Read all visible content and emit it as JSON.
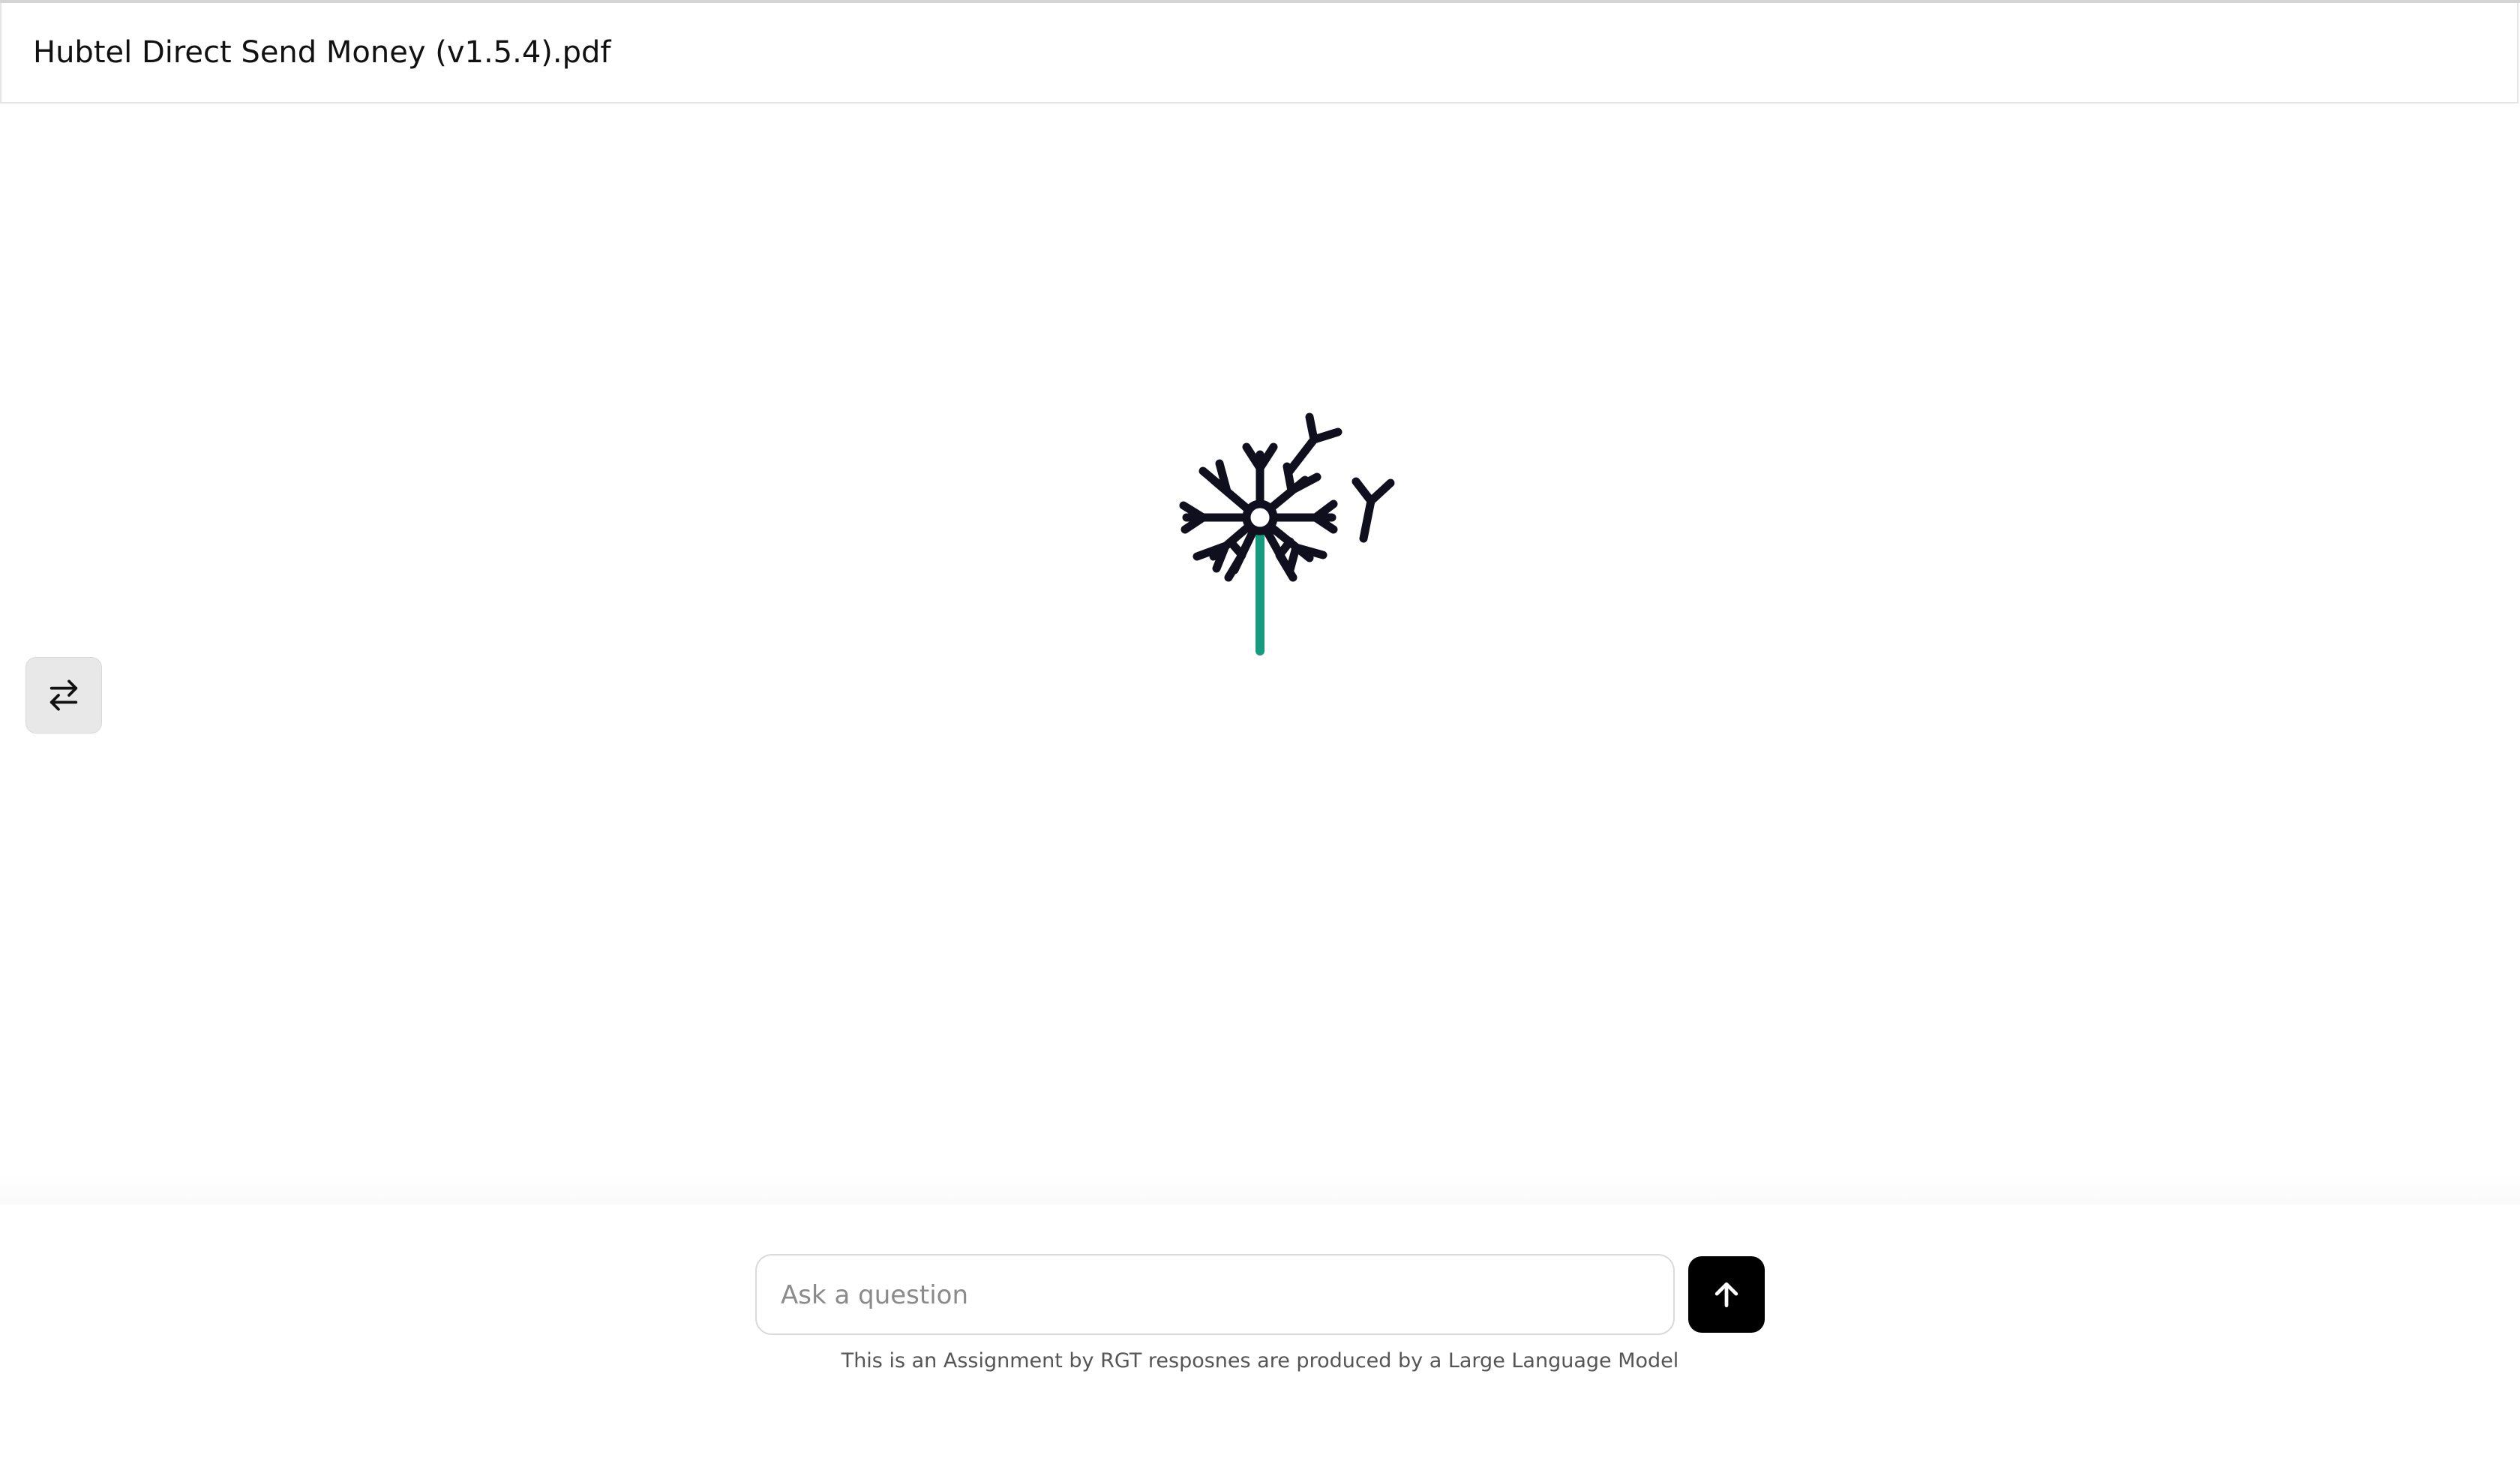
{
  "header": {
    "document_title": "Hubtel Direct Send Money (v1.5.4).pdf"
  },
  "logo": {
    "icon": "dandelion-logo-icon",
    "colors": {
      "head": "#0f0f1e",
      "stem": "#169b7f"
    }
  },
  "sidebar_toggle": {
    "icon": "swap-arrows-icon"
  },
  "composer": {
    "placeholder": "Ask a question",
    "value": "",
    "send_icon": "arrow-up-icon"
  },
  "footer": {
    "disclaimer": "This is an Assignment by RGT resposnes are produced by a Large Language Model"
  },
  "colors": {
    "send_button_bg": "#000000",
    "toggle_bg": "#e8e8e8",
    "border": "#d9d9d9"
  }
}
